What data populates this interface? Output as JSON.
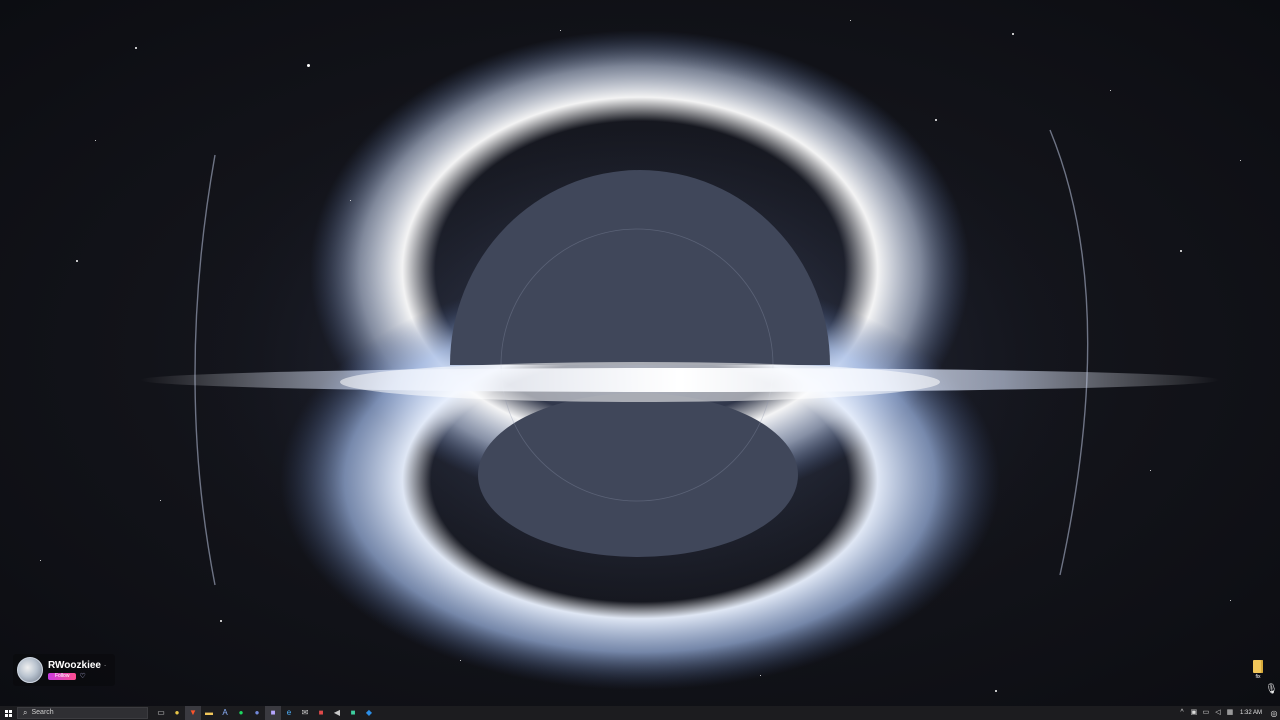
{
  "desktop": {
    "streamer_overlay": {
      "name": "RWoozkiee",
      "follow_label": "Follow"
    },
    "icons": [
      {
        "label": "fix",
        "icon": "folder-icon",
        "color": "#f1c65a"
      }
    ]
  },
  "taskbar": {
    "search": {
      "placeholder": "Search"
    },
    "pinned_apps": [
      {
        "name": "task-view-icon",
        "glyph": "▭"
      },
      {
        "name": "chrome-icon",
        "glyph": "●",
        "color": "#e8c547"
      },
      {
        "name": "brave-icon",
        "glyph": "▼",
        "color": "#fb542b",
        "active": true
      },
      {
        "name": "file-explorer-icon",
        "glyph": "▬",
        "color": "#f1c65a"
      },
      {
        "name": "arc-icon",
        "glyph": "A",
        "color": "#8fb4ff"
      },
      {
        "name": "spotify-icon",
        "glyph": "●",
        "color": "#1ed760"
      },
      {
        "name": "discord-icon",
        "glyph": "●",
        "color": "#7289da"
      },
      {
        "name": "obs-icon",
        "glyph": "■",
        "color": "#b6a6ff",
        "active": true
      },
      {
        "name": "edge-icon",
        "glyph": "e",
        "color": "#4fb3ff"
      },
      {
        "name": "email-icon",
        "glyph": "✉",
        "color": "#d0d0d0"
      },
      {
        "name": "calendar-icon",
        "glyph": "■",
        "color": "#e04a4a"
      },
      {
        "name": "volume-app-icon",
        "glyph": "◀",
        "color": "#c8c8c8"
      },
      {
        "name": "terminal-icon",
        "glyph": "■",
        "color": "#3ecfa0"
      },
      {
        "name": "vscode-icon",
        "glyph": "◆",
        "color": "#2c8ee6"
      }
    ],
    "tray": {
      "icons": [
        {
          "name": "chevron-up-icon",
          "glyph": "^"
        },
        {
          "name": "display-icon",
          "glyph": "▣"
        },
        {
          "name": "network-icon",
          "glyph": "▭"
        },
        {
          "name": "speaker-icon",
          "glyph": "◁"
        },
        {
          "name": "language-icon",
          "glyph": "▦"
        }
      ],
      "time": "1:32 AM"
    }
  }
}
